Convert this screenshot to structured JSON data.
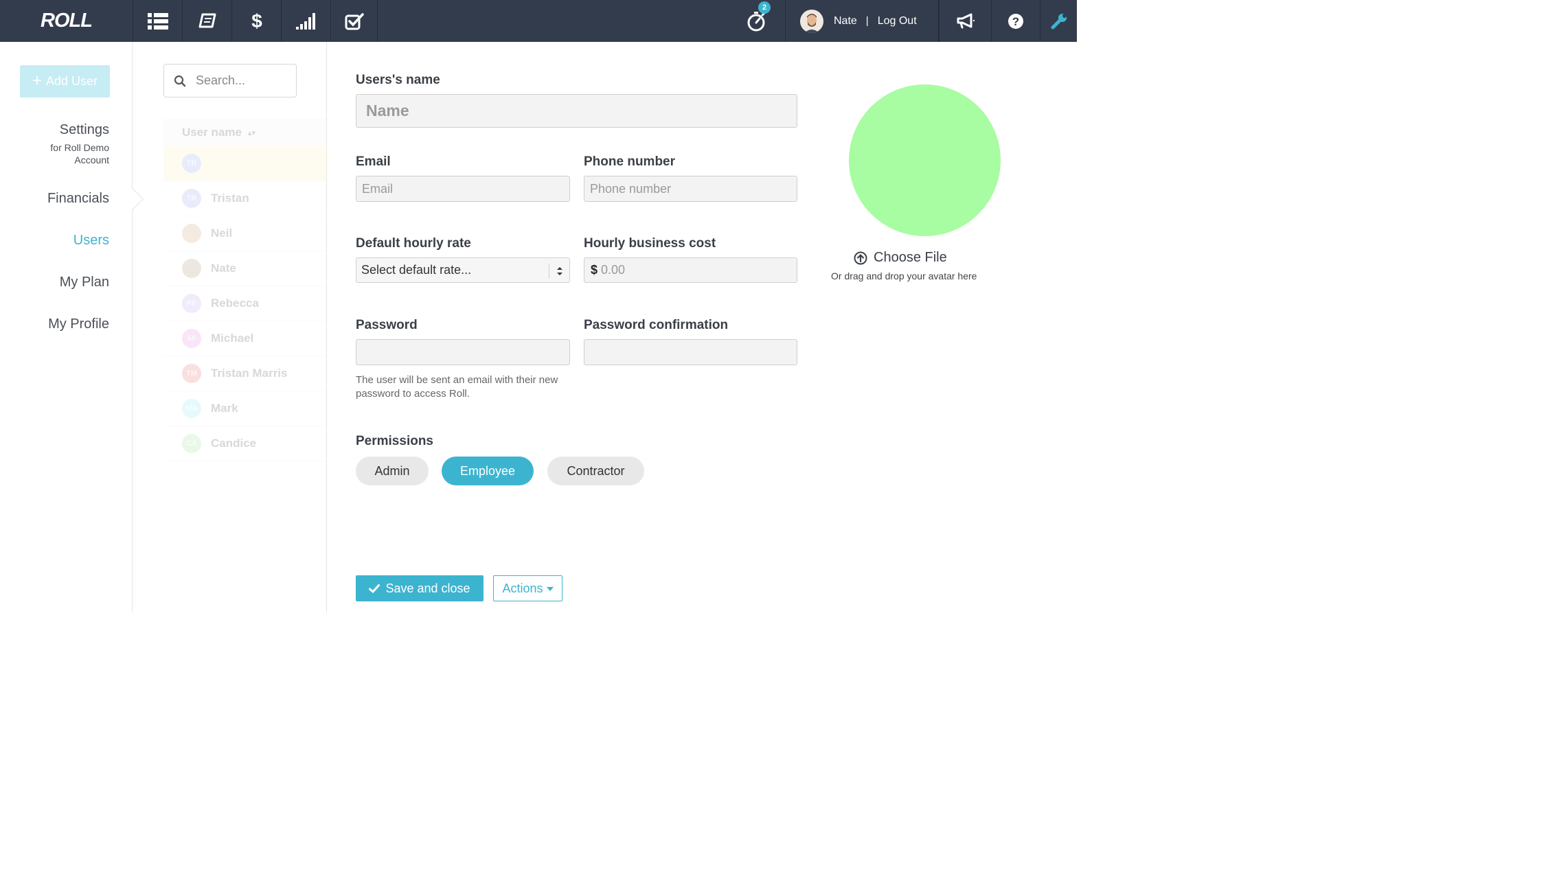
{
  "header": {
    "logo": "ROLL",
    "nav_icons": [
      "list-icon",
      "book-icon",
      "dollar-icon",
      "signal-bars-icon",
      "checkbox-icon"
    ],
    "timer_badge": "2",
    "user_name": "Nate",
    "divider": "|",
    "logout_label": "Log Out",
    "right_icons": [
      "megaphone-icon",
      "help-icon",
      "wrench-icon"
    ]
  },
  "left_menu": {
    "add_user_label": "Add User",
    "settings_label": "Settings",
    "settings_sub_1": "for Roll Demo",
    "settings_sub_2": "Account",
    "items": [
      {
        "label": "Financials",
        "active": false
      },
      {
        "label": "Users",
        "active": true
      },
      {
        "label": "My Plan",
        "active": false
      },
      {
        "label": "My Profile",
        "active": false
      }
    ]
  },
  "user_list": {
    "search_placeholder": "Search...",
    "column_header": "User name",
    "rows": [
      {
        "initials": "TR",
        "name": "",
        "color": "#a8b4f0"
      },
      {
        "initials": "TR",
        "name": "Tristan",
        "color": "#a8b4f0"
      },
      {
        "initials": "",
        "name": "Neil",
        "color": "#d9b08c"
      },
      {
        "initials": "",
        "name": "Nate",
        "color": "#b9a38f"
      },
      {
        "initials": "RE",
        "name": "Rebecca",
        "color": "#c9b2f2"
      },
      {
        "initials": "MI",
        "name": "Michael",
        "color": "#e89be0"
      },
      {
        "initials": "TM",
        "name": "Tristan Marris",
        "color": "#f07f7f"
      },
      {
        "initials": "MA",
        "name": "Mark",
        "color": "#9eeef0"
      },
      {
        "initials": "CA",
        "name": "Candice",
        "color": "#a9e6a4"
      }
    ]
  },
  "form": {
    "name_label": "Users's name",
    "name_placeholder": "Name",
    "email_label": "Email",
    "email_placeholder": "Email",
    "phone_label": "Phone number",
    "phone_placeholder": "Phone number",
    "rate_label": "Default hourly rate",
    "rate_select_value": "Select default rate...",
    "cost_label": "Hourly business cost",
    "cost_currency": "$",
    "cost_placeholder": "0.00",
    "password_label": "Password",
    "password_confirm_label": "Password confirmation",
    "password_help": "The user will be sent an email with their new password to access Roll.",
    "permissions_label": "Permissions",
    "permissions": [
      {
        "label": "Admin",
        "selected": false
      },
      {
        "label": "Employee",
        "selected": true
      },
      {
        "label": "Contractor",
        "selected": false
      }
    ],
    "save_label": "Save and close",
    "actions_label": "Actions"
  },
  "avatar": {
    "color": "#a8fca1",
    "choose_file_label": "Choose File",
    "drag_hint": "Or drag and drop your avatar here"
  },
  "colors": {
    "topbar": "#333c4d",
    "accent": "#3cb4cf"
  }
}
